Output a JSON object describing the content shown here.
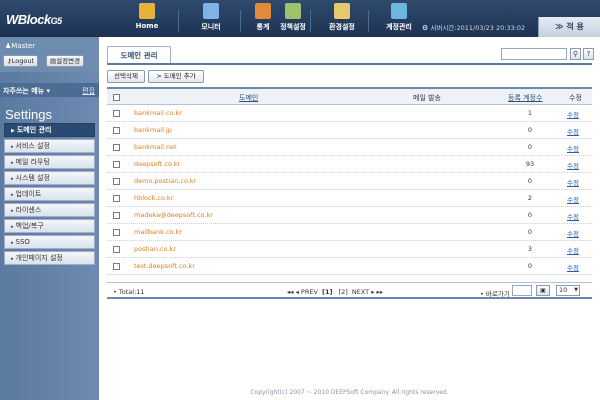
{
  "header": {
    "logo": "WBlock",
    "logo_suffix": "G5",
    "nav": [
      {
        "label": "Home",
        "icon": "home-icon",
        "color": "#e8b23a"
      },
      {
        "label": "모니터",
        "icon": "monitor-icon",
        "color": "#7fb2e6"
      },
      {
        "label": "통계",
        "icon": "chart-icon",
        "color": "#e08a3a"
      },
      {
        "label": "정책설정",
        "icon": "policy-icon",
        "color": "#9dc36a"
      },
      {
        "label": "환경설정",
        "icon": "config-icon",
        "color": "#e6c96a"
      },
      {
        "label": "계정관리",
        "icon": "account-icon",
        "color": "#6ab7e0"
      }
    ],
    "server_time": "서버시간:2011/03/23 20:33:02",
    "apply_label": "≫ 적 용"
  },
  "sidebar": {
    "username": "Master",
    "logout_label": "Logout",
    "settings_change_label": "설정변경",
    "favorites_label": "자주쓰는 메뉴",
    "favorites_edit": "편집",
    "settings_title": "Settings",
    "items": [
      {
        "label": "도메인 관리",
        "active": true
      },
      {
        "label": "서비스 설정",
        "active": false
      },
      {
        "label": "메일 라우팅",
        "active": false
      },
      {
        "label": "시스템 설정",
        "active": false
      },
      {
        "label": "업데이트",
        "active": false
      },
      {
        "label": "라이센스",
        "active": false
      },
      {
        "label": "백업/복구",
        "active": false
      },
      {
        "label": "SSO",
        "active": false
      },
      {
        "label": "개인페이지 설정",
        "active": false
      }
    ]
  },
  "main": {
    "tab_label": "도메인 관리",
    "search": {
      "value": "",
      "placeholder": ""
    },
    "delete_label": "선택삭제",
    "add_label": "> 도메인 추가",
    "columns": {
      "domain": "도메인",
      "outbound": "메일 발송",
      "accounts": "등록 계정수",
      "edit": "수정"
    },
    "rows": [
      {
        "domain": "bankmail.co.kr",
        "accounts": "1",
        "edit": "수정"
      },
      {
        "domain": "bankmail.jp",
        "accounts": "0",
        "edit": "수정"
      },
      {
        "domain": "bankmail.net",
        "accounts": "0",
        "edit": "수정"
      },
      {
        "domain": "deepsoft.co.kr",
        "accounts": "93",
        "edit": "수정"
      },
      {
        "domain": "demo.postian.co.kr",
        "accounts": "0",
        "edit": "수정"
      },
      {
        "domain": "hblock.co.kr",
        "accounts": "2",
        "edit": "수정"
      },
      {
        "domain": "madeka@deepsoft.co.kr",
        "accounts": "0",
        "edit": "수정"
      },
      {
        "domain": "mailbank.co.kr",
        "accounts": "0",
        "edit": "수정"
      },
      {
        "domain": "postian.co.kr",
        "accounts": "3",
        "edit": "수정"
      },
      {
        "domain": "test.deepsoft.co.kr",
        "accounts": "0",
        "edit": "수정"
      }
    ],
    "total": "Total:11",
    "pager": {
      "prev": "◂◂ ◂ PREV",
      "pages": [
        "[1]",
        "[2]"
      ],
      "next": "NEXT ▸ ▸▸"
    },
    "goto_label": "바로가기",
    "goto_value": "",
    "per_page": "10"
  },
  "footer": {
    "copyright": "Copyright(c) 2007 ~ 2010 DEEPSoft Company. All rights reserved."
  }
}
